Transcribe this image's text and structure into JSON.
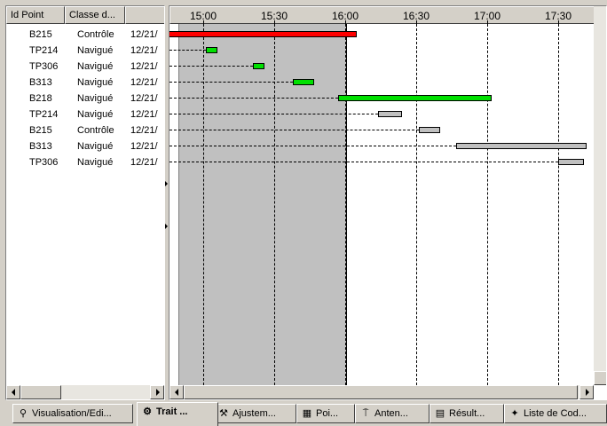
{
  "list": {
    "columns": [
      "Id Point",
      "Classe d...",
      ""
    ],
    "rows": [
      {
        "id": "B215",
        "classe": "Contrôle",
        "date": "12/21/"
      },
      {
        "id": "TP214",
        "classe": "Navigué",
        "date": "12/21/"
      },
      {
        "id": "TP306",
        "classe": "Navigué",
        "date": "12/21/"
      },
      {
        "id": "B313",
        "classe": "Navigué",
        "date": "12/21/"
      },
      {
        "id": "B218",
        "classe": "Navigué",
        "date": "12/21/"
      },
      {
        "id": "TP214",
        "classe": "Navigué",
        "date": "12/21/"
      },
      {
        "id": "B215",
        "classe": "Contrôle",
        "date": "12/21/"
      },
      {
        "id": "B313",
        "classe": "Navigué",
        "date": "12/21/"
      },
      {
        "id": "TP306",
        "classe": "Navigué",
        "date": "12/21/"
      }
    ]
  },
  "timeline": {
    "ticks": [
      "15:00",
      "15:30",
      "16:00",
      "16:30",
      "17:00",
      "17:30"
    ],
    "shaded_end": "16:00",
    "colors": {
      "red": "#ff0000",
      "green": "#00e000",
      "gray": "#c0c0c0",
      "shade": "#c0c0c0"
    },
    "bars": [
      {
        "start": "14:45",
        "end": "16:05",
        "color": "red"
      },
      {
        "start": "15:01",
        "end": "15:06",
        "color": "green"
      },
      {
        "start": "15:21",
        "end": "15:26",
        "color": "green"
      },
      {
        "start": "15:38",
        "end": "15:47",
        "color": "green"
      },
      {
        "start": "15:57",
        "end": "17:02",
        "color": "green"
      },
      {
        "start": "16:14",
        "end": "16:24",
        "color": "gray"
      },
      {
        "start": "16:31",
        "end": "16:40",
        "color": "gray"
      },
      {
        "start": "16:47",
        "end": "17:42",
        "color": "gray"
      },
      {
        "start": "17:30",
        "end": "17:41",
        "color": "gray"
      }
    ]
  },
  "tabs": [
    {
      "label": "Visualisation/Edi...",
      "icon": "binoculars-icon",
      "glyph": "⚲",
      "active": false
    },
    {
      "label": "Trait ...",
      "icon": "gear-icon",
      "glyph": "⚙",
      "active": true
    },
    {
      "label": "Ajustem...",
      "icon": "tools-icon",
      "glyph": "⚒",
      "active": false
    },
    {
      "label": "Poi...",
      "icon": "points-icon",
      "glyph": "▦",
      "active": false
    },
    {
      "label": "Anten...",
      "icon": "antenna-icon",
      "glyph": "⍑",
      "active": false
    },
    {
      "label": "Résult...",
      "icon": "results-icon",
      "glyph": "▤",
      "active": false
    },
    {
      "label": "Liste de Cod...",
      "icon": "code-list-icon",
      "glyph": "✦",
      "active": false
    }
  ]
}
